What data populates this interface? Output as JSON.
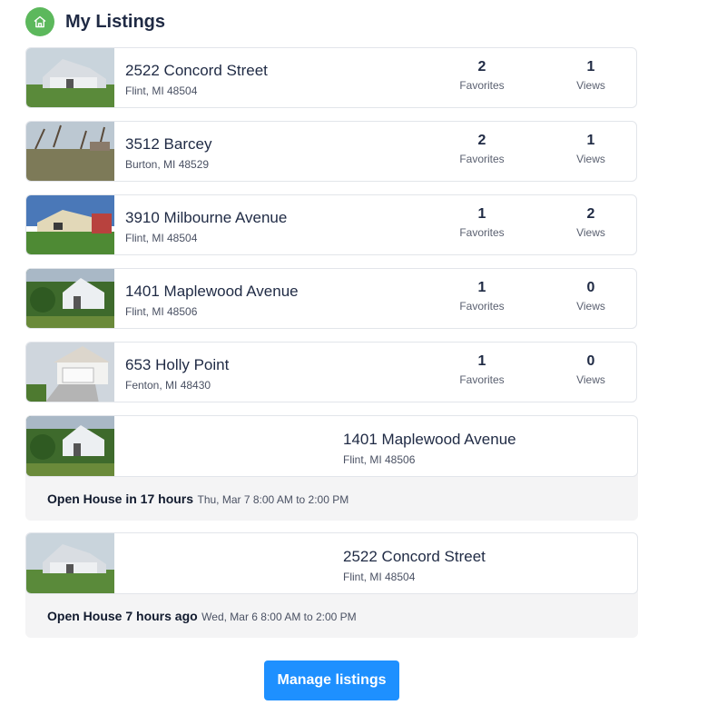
{
  "page_title": "My Listings",
  "colors": {
    "accent": "#1e90ff",
    "badge": "#5cb85c",
    "text": "#1f2a44"
  },
  "icons": {
    "header": "home-icon"
  },
  "listings": [
    {
      "street": "2522 Concord Street",
      "city": "Flint, MI 48504",
      "favorites": "2",
      "favorites_label": "Favorites",
      "views": "1",
      "views_label": "Views"
    },
    {
      "street": "3512 Barcey",
      "city": "Burton, MI 48529",
      "favorites": "2",
      "favorites_label": "Favorites",
      "views": "1",
      "views_label": "Views"
    },
    {
      "street": "3910 Milbourne Avenue",
      "city": "Flint, MI 48504",
      "favorites": "1",
      "favorites_label": "Favorites",
      "views": "2",
      "views_label": "Views"
    },
    {
      "street": "1401 Maplewood Avenue",
      "city": "Flint, MI 48506",
      "favorites": "1",
      "favorites_label": "Favorites",
      "views": "0",
      "views_label": "Views"
    },
    {
      "street": "653 Holly Point",
      "city": "Fenton, MI 48430",
      "favorites": "1",
      "favorites_label": "Favorites",
      "views": "0",
      "views_label": "Views"
    }
  ],
  "open_houses": [
    {
      "street": "1401 Maplewood Avenue",
      "city": "Flint, MI 48506",
      "title": "Open House in 17 hours",
      "time": "Thu, Mar 7 8:00 AM to 2:00 PM"
    },
    {
      "street": "2522 Concord Street",
      "city": "Flint, MI 48504",
      "title": "Open House 7 hours ago",
      "time": "Wed, Mar 6 8:00 AM to 2:00 PM"
    }
  ],
  "manage_button": "Manage listings"
}
